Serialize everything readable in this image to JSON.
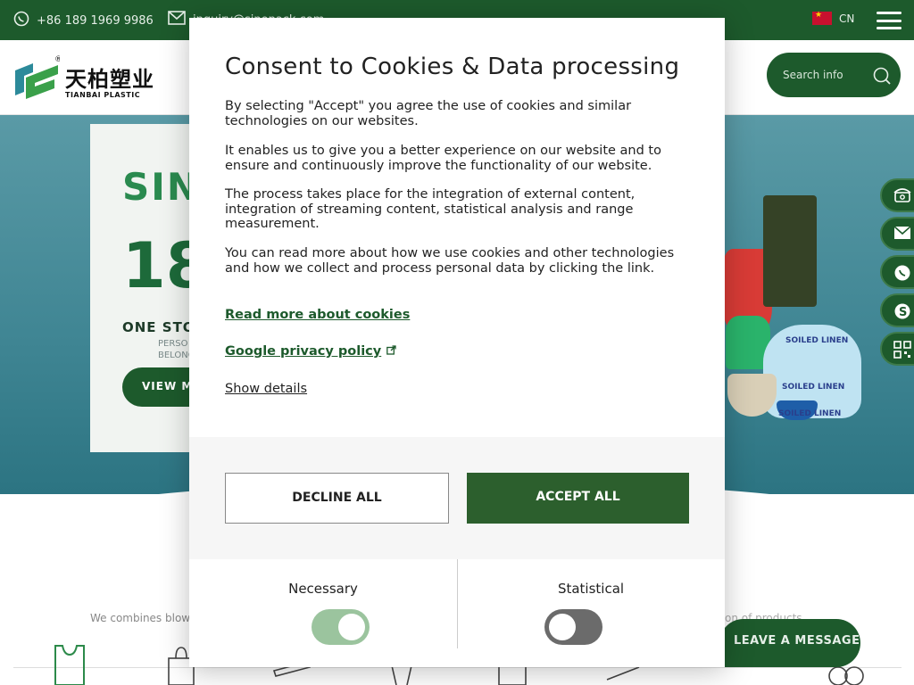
{
  "topbar": {
    "phone": "+86 189 1969 9986",
    "email": "inquiry@sinopack.com",
    "lang": "CN"
  },
  "header": {
    "logo_cn": "天柏塑业",
    "logo_en": "TIANBAI PLASTIC",
    "search_placeholder": "Search info"
  },
  "hero": {
    "headline_1": "SINC",
    "headline_2": "18",
    "tagline": "ONE STO",
    "small_1": "PERSO",
    "small_2": "BELONG",
    "button": "VIEW MO",
    "bag_labels": [
      "SOILED LINEN",
      "SOILED LINEN",
      "SOILED LINEN"
    ]
  },
  "page": {
    "intro_left": "We combines blow",
    "intro_right": "cation of products",
    "leave_message": "LEAVE A MESSAGE"
  },
  "consent": {
    "title": "Consent to Cookies & Data processing",
    "p1": "By selecting \"Accept\" you agree the use of cookies and similar technologies on our websites.",
    "p2": "It enables us to give you a better experience on our website and to ensure and continuously improve the functionality of our website.",
    "p3": "The process takes place for the integration of external content, integration of streaming content, statistical analysis and range measurement.",
    "p4": "You can read more about how we use cookies and other technologies and how we collect and process personal data by clicking the link.",
    "link_cookies": "Read more about cookies",
    "link_google": "Google privacy policy",
    "show_details": "Show details",
    "decline": "DECLINE ALL",
    "accept": "ACCEPT ALL",
    "categories": [
      {
        "label": "Necessary",
        "enabled": true
      },
      {
        "label": "Statistical",
        "enabled": false
      }
    ]
  },
  "colors": {
    "brand_green": "#1d5a2c",
    "accept_green": "#2c5f2d",
    "toggle_on": "#9bc49e",
    "toggle_off": "#6b6b6b"
  }
}
